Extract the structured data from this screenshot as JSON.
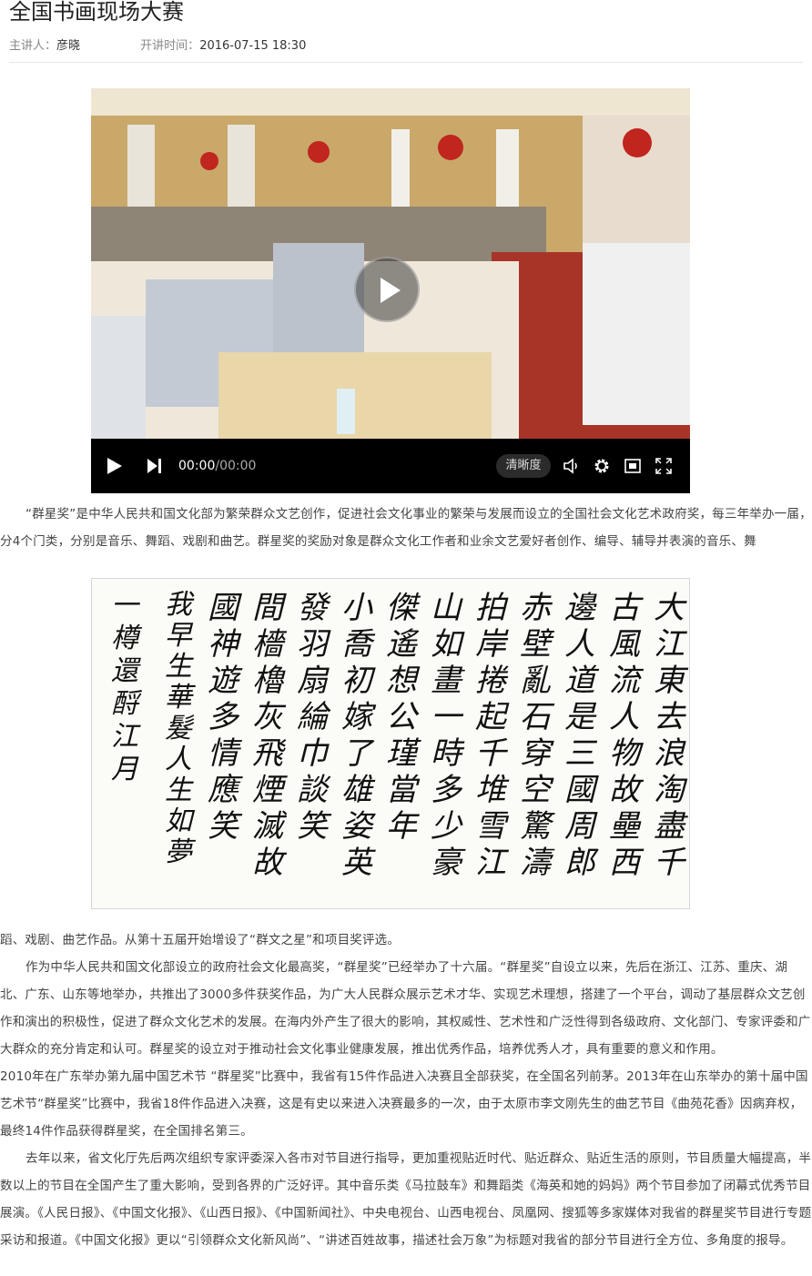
{
  "header": {
    "title": "全国书画现场大赛",
    "speaker_label": "主讲人：",
    "speaker": "彦晓",
    "time_label": "开讲时间：",
    "time": "2016-07-15  18:30"
  },
  "video": {
    "current_time": "00:00",
    "duration": "/00:00",
    "clarity_label": "清晰度",
    "play_icon": "play-icon",
    "next_icon": "next-icon",
    "volume_icon": "volume-icon",
    "settings_icon": "gear-icon",
    "pip_icon": "picture-in-picture-icon",
    "fullscreen_icon": "fullscreen-icon"
  },
  "calligraphy": {
    "columns": [
      "大江東去浪淘盡千",
      "古風流人物故壘西",
      "邊人道是三國周郎",
      "赤壁亂石穿空驚濤",
      "拍岸捲起千堆雪江",
      "山如畫一時多少豪",
      "傑遙想公瑾當年",
      "小喬初嫁了雄姿英",
      "發羽扇綸巾談笑",
      "間檣櫓灰飛煙滅故",
      "國神遊多情應笑",
      "我早生華髮人生如夢",
      "一樽還酹江月"
    ]
  },
  "article": {
    "p1": "“群星奖”是中华人民共和国文化部为繁荣群众文艺创作，促进社会文化事业的繁荣与发展而设立的全国社会文化艺术政府奖，每三年举办一届，分4个门类，分别是音乐、舞蹈、戏剧和曲艺。群星奖的奖励对象是群众文化工作者和业余文艺爱好者创作、编导、辅导并表演的音乐、舞",
    "p1b": "蹈、戏剧、曲艺作品。从第十五届开始增设了“群文之星”和项目奖评选。",
    "p2": "作为中华人民共和国文化部设立的政府社会文化最高奖，“群星奖”已经举办了十六届。“群星奖”自设立以来，先后在浙江、江苏、重庆、湖北、广东、山东等地举办，共推出了3000多件获奖作品，为广大人民群众展示艺术才华、实现艺术理想，搭建了一个平台，调动了基层群众文艺创作和演出的积极性，促进了群众文化艺术的发展。在海内外产生了很大的影响，其权威性、艺术性和广泛性得到各级政府、文化部门、专家评委和广大群众的充分肯定和认可。群星奖的设立对于推动社会文化事业健康发展，推出优秀作品，培养优秀人才，具有重要的意义和作用。",
    "p3": "2010年在广东举办第九届中国艺术节 “群星奖”比赛中，我省有15件作品进入决赛且全部获奖，在全国名列前茅。2013年在山东举办的第十届中国艺术节“群星奖”比赛中，我省18件作品进入决赛，这是有史以来进入决赛最多的一次，由于太原市李文刚先生的曲艺节目《曲苑花香》因病弃权，最终14件作品获得群星奖，在全国排名第三。",
    "p4": "去年以来，省文化厅先后两次组织专家评委深入各市对节目进行指导，更加重视贴近时代、贴近群众、贴近生活的原则，节目质量大幅提高，半数以上的节目在全国产生了重大影响，受到各界的广泛好评。其中音乐类《马拉鼓车》和舞蹈类《海英和她的妈妈》两个节目参加了闭幕式优秀节目展演。《人民日报》、《中国文化报》、《山西日报》、《中国新闻社》、中央电视台、山西电视台、凤凰网、搜狐等多家媒体对我省的群星奖节目进行专题采访和报道。《中国文化报》更以“引领群众文化新风尚”、“讲述百姓故事，描述社会万象”为标题对我省的部分节目进行全方位、多角度的报导。"
  }
}
